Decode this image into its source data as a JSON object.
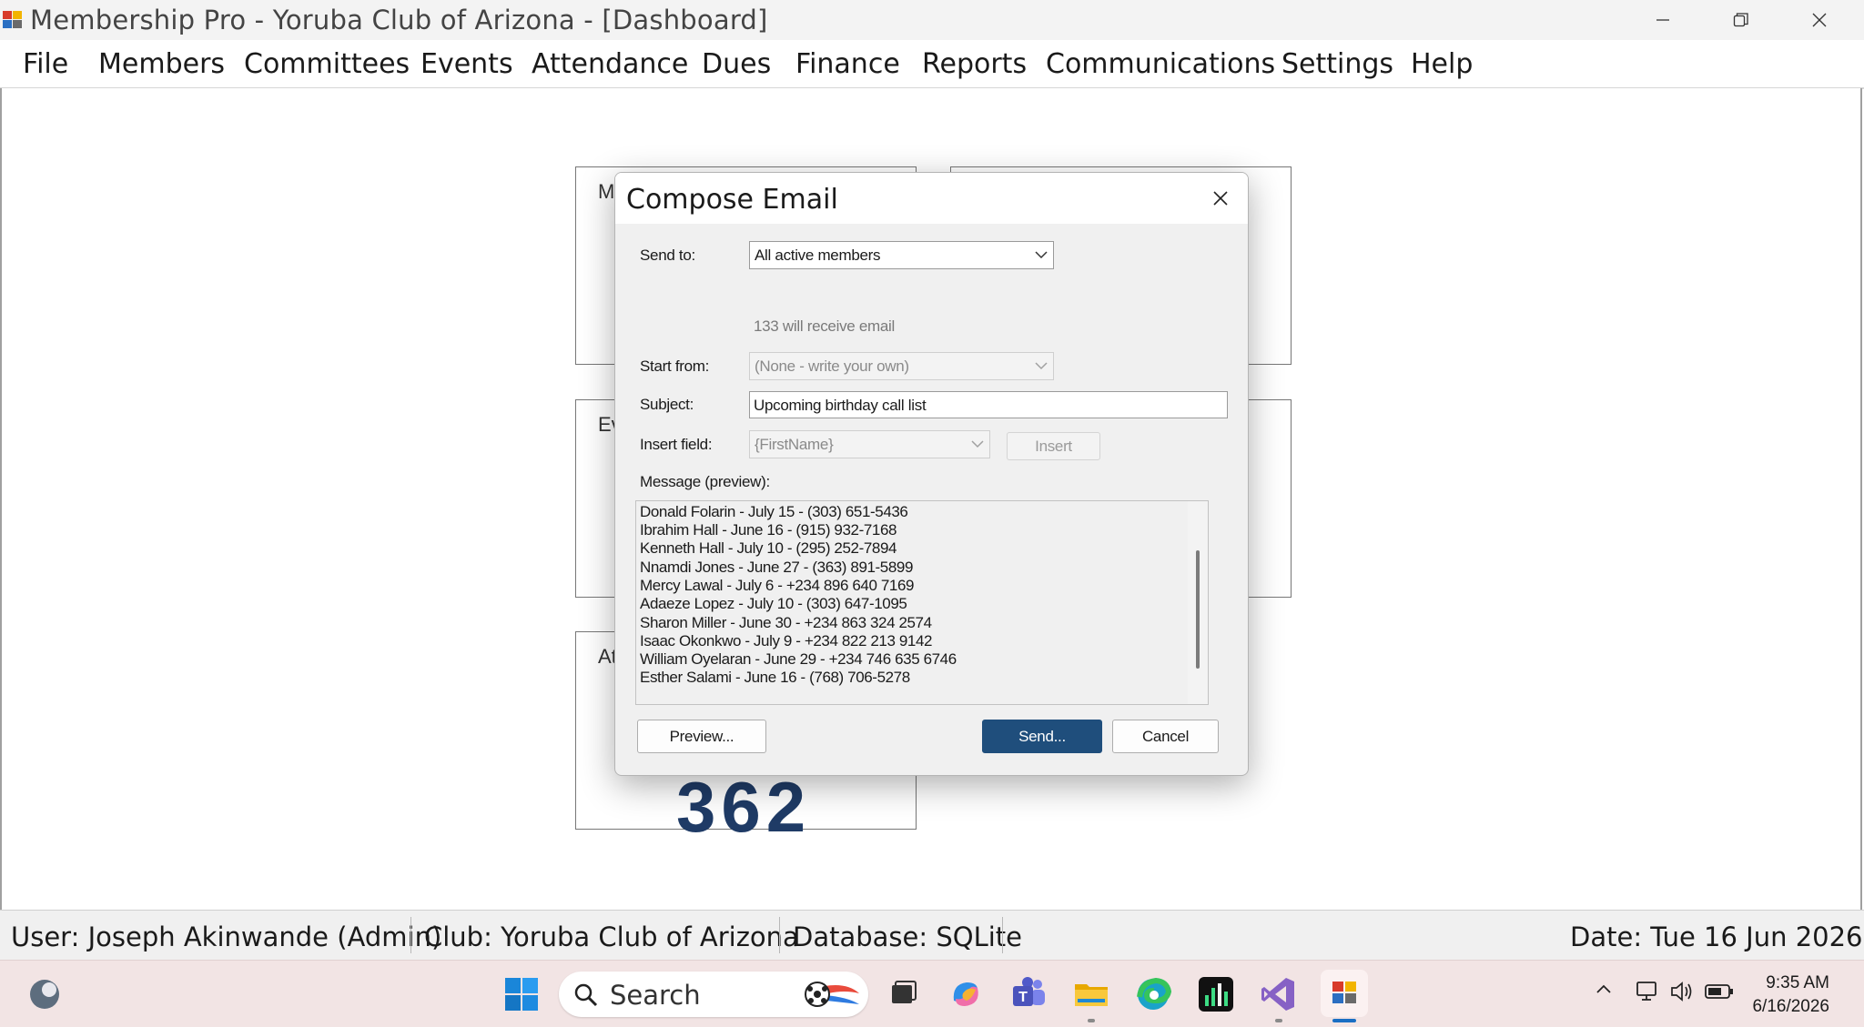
{
  "window": {
    "title": "Membership Pro  -  Yoruba Club of Arizona - [Dashboard]"
  },
  "menu": [
    "File",
    "Members",
    "Committees",
    "Events",
    "Attendance",
    "Dues",
    "Finance",
    "Reports",
    "Communications",
    "Settings",
    "Help"
  ],
  "dashboard": {
    "cards": [
      {
        "label": "M"
      },
      {
        "label": "Ev"
      },
      {
        "label": "At",
        "value": "362"
      },
      {
        "label": ""
      },
      {
        "label": ""
      }
    ]
  },
  "dialog": {
    "title": "Compose Email",
    "send_to_label": "Send to:",
    "send_to_value": "All active members",
    "recipients_note": "133 will receive email",
    "start_from_label": "Start from:",
    "start_from_value": "(None - write your own)",
    "subject_label": "Subject:",
    "subject_value": "Upcoming birthday call list",
    "insert_field_label": "Insert field:",
    "insert_field_value": "{FirstName}",
    "insert_button": "Insert",
    "message_label": "Message (preview):",
    "message_lines": [
      "Donald Folarin  -  July 15  -  (303) 651-5436",
      "Ibrahim Hall  -  June 16  -  (915) 932-7168",
      "Kenneth Hall  -  July 10  -  (295) 252-7894",
      "Nnamdi Jones  -  June 27  -  (363) 891-5899",
      "Mercy Lawal  -  July 6  -  +234 896 640 7169",
      "Adaeze Lopez  -  July 10  -  (303) 647-1095",
      "Sharon Miller  -  June 30  -  +234 863 324 2574",
      "Isaac Okonkwo  -  July 9  -  +234 822 213 9142",
      "William Oyelaran  -  June 29  -  +234 746 635 6746",
      "Esther Salami  -  June 16  -  (768) 706-5278"
    ],
    "preview_button": "Preview...",
    "send_button": "Send...",
    "cancel_button": "Cancel"
  },
  "status": {
    "user": "User: Joseph Akinwande (Admin)",
    "club": "Club: Yoruba Club of Arizona",
    "database": "Database: SQLite",
    "date": "Date: Tue  16 Jun 2026"
  },
  "taskbar": {
    "search_label": "Search",
    "time": "9:35 AM",
    "date": "6/16/2026",
    "icons": [
      "widgets-icon",
      "windows-start-icon",
      "search-icon",
      "task-view-icon",
      "copilot-icon",
      "teams-icon",
      "file-explorer-icon",
      "edge-icon",
      "stock-chart-app-icon",
      "visual-studio-icon",
      "membership-pro-icon",
      "chevron-up-icon",
      "network-icon",
      "volume-icon",
      "battery-icon"
    ]
  },
  "colors": {
    "accent": "#1f4e7c",
    "taskbar_bg": "#f2e4e4",
    "card_number": "#1f3b66"
  }
}
